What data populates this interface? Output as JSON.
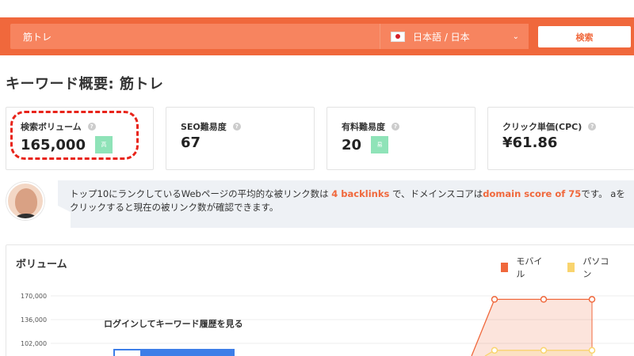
{
  "search": {
    "value": "筋トレ",
    "language": "日本語 / 日本",
    "button_label": "検索"
  },
  "page_title": "キーワード概要: 筋トレ",
  "cards": [
    {
      "label": "検索ボリューム",
      "value": "165,000",
      "badge": "高"
    },
    {
      "label": "SEO難易度",
      "value": "67"
    },
    {
      "label": "有料難易度",
      "value": "20",
      "badge": "易"
    },
    {
      "label": "クリック単価(CPC)",
      "value": "¥61.86"
    }
  ],
  "tip": {
    "part1": "トップ10にランクしているWebページの平均的な被リンク数は",
    "backlinks": "4 backlinks",
    "part2": "で、ドメインスコアは",
    "domain_score": "domain score of 75",
    "part3": "です。 aをクリックすると現在の被リンク数が確認できます。"
  },
  "volume": {
    "title": "ボリューム",
    "legend": [
      {
        "name": "モバイル",
        "color": "#f0683c"
      },
      {
        "name": "パソコン",
        "color": "#f9d46e"
      }
    ],
    "login_text": "ログインしてキーワード履歴を見る"
  },
  "chart_data": {
    "type": "area",
    "y_ticks": [
      "170,000",
      "136,000",
      "102,000"
    ],
    "ylim": [
      68000,
      170000
    ],
    "series": [
      {
        "name": "モバイル",
        "values": [
          165000,
          165000,
          165000
        ]
      },
      {
        "name": "パソコン",
        "values": [
          92000,
          92000,
          92000
        ]
      }
    ]
  }
}
